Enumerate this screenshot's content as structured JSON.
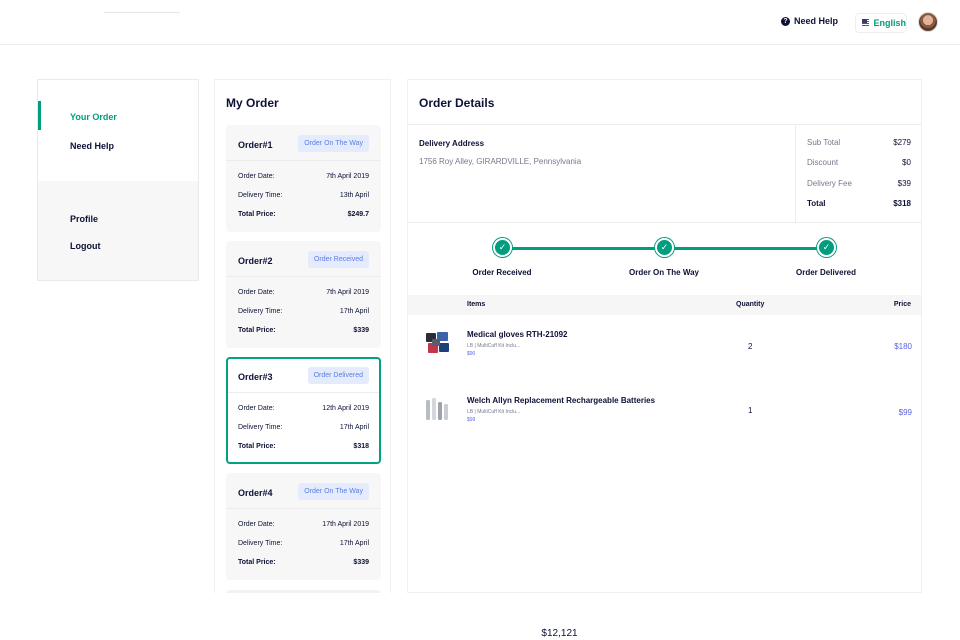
{
  "header": {
    "need_help": "Need Help",
    "language": "English"
  },
  "sidebar": {
    "items": [
      {
        "label": "Your Order"
      },
      {
        "label": "Need Help"
      },
      {
        "label": "Profile"
      },
      {
        "label": "Logout"
      }
    ]
  },
  "my_order": {
    "title": "My Order",
    "labels": {
      "order_date": "Order Date:",
      "delivery_time": "Delivery Time:",
      "total_price": "Total Price:"
    },
    "orders": [
      {
        "number": "Order#1",
        "status": "Order On The Way",
        "order_date": "7th April 2019",
        "delivery_time": "13th April",
        "total_price": "$249.7"
      },
      {
        "number": "Order#2",
        "status": "Order Received",
        "order_date": "7th April 2019",
        "delivery_time": "17th April",
        "total_price": "$339"
      },
      {
        "number": "Order#3",
        "status": "Order Delivered",
        "order_date": "12th April 2019",
        "delivery_time": "17th April",
        "total_price": "$318"
      },
      {
        "number": "Order#4",
        "status": "Order On The Way",
        "order_date": "17th April 2019",
        "delivery_time": "17th April",
        "total_price": "$339"
      }
    ]
  },
  "details": {
    "title": "Order Details",
    "delivery_address_label": "Delivery Address",
    "delivery_address": "1756 Roy Alley, GIRARDVILLE, Pennsylvania",
    "summary": [
      {
        "label": "Sub Total",
        "value": "$279"
      },
      {
        "label": "Discount",
        "value": "$0"
      },
      {
        "label": "Delivery Fee",
        "value": "$39"
      },
      {
        "label": "Total",
        "value": "$318"
      }
    ],
    "steps": [
      "Order Received",
      "Order On The Way",
      "Order Delivered"
    ],
    "table_headers": {
      "items": "Items",
      "quantity": "Quantity",
      "price": "Price"
    },
    "items": [
      {
        "name": "Medical gloves RTH-21092",
        "meta": "LB | MultiCuff Kit Inclu...",
        "unit_price": "$90",
        "quantity": "2",
        "price": "$180"
      },
      {
        "name": "Welch Allyn Replacement Rechargeable Batteries",
        "meta": "LB | MultiCuff Kit Inclu...",
        "unit_price": "$99",
        "quantity": "1",
        "price": "$99"
      }
    ]
  },
  "footer_total": "$12,121",
  "colors": {
    "accent": "#009e7f",
    "badge_bg": "#e3ebfc",
    "badge_text": "#5b7ee6",
    "price": "#5b63e6"
  }
}
